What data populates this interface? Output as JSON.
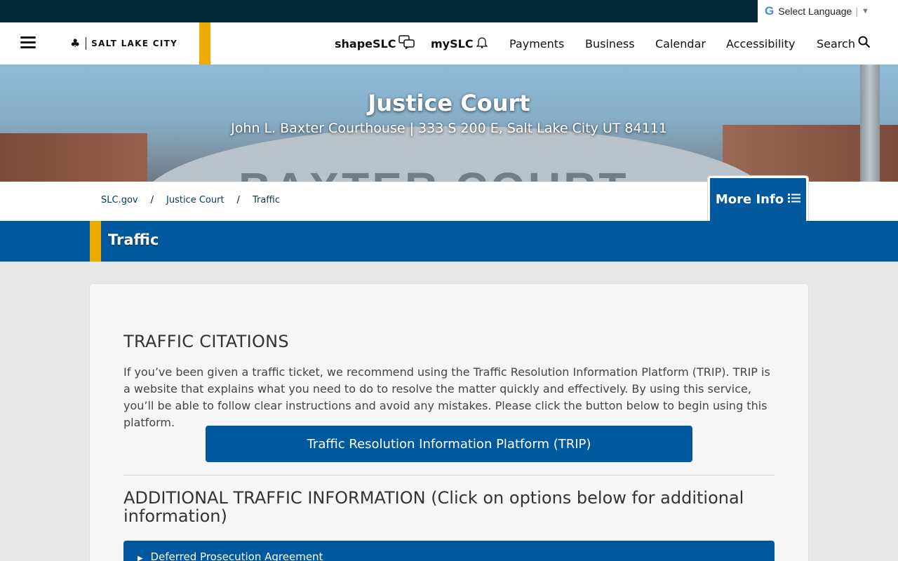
{
  "language": {
    "label": "Select Language",
    "g_logo": "G",
    "arrow": "▼"
  },
  "header": {
    "logo_text": "SALT LAKE CITY",
    "nav": [
      {
        "label": "shapeSLC",
        "icon": "chat-bubbles-icon"
      },
      {
        "label": "mySLC",
        "icon": "bell-icon"
      },
      {
        "label": "Payments"
      },
      {
        "label": "Business"
      },
      {
        "label": "Calendar"
      },
      {
        "label": "Accessibility"
      },
      {
        "label": "Search",
        "icon": "search-icon"
      }
    ]
  },
  "hero": {
    "title": "Justice Court",
    "subtitle": "John L. Baxter Courthouse | 333 S 200 E, Salt Lake City UT 84111",
    "carved_text": "BAXTER COURT"
  },
  "breadcrumb": [
    "SLC.gov",
    "Justice Court",
    "Traffic"
  ],
  "more_info": {
    "label": "More Info"
  },
  "page_title": "Traffic",
  "content": {
    "heading": "TRAFFIC CITATIONS",
    "paragraph": "If you’ve been given a traffic ticket, we recommend using the Traffic Resolution Information Platform (TRIP). TRIP is a website that explains what you need to do to resolve the matter quickly and effectively. By using this service, you’ll be able to follow clear instructions and avoid any mistakes. Please click the button below to begin using this platform.",
    "trip_button": "Traffic Resolution Information Platform (TRIP)",
    "additional_heading": "ADDITIONAL TRAFFIC INFORMATION (Click on options below for additional information)",
    "accordion_items": [
      "Deferred Prosecution Agreement"
    ]
  },
  "colors": {
    "primary_blue": "#00599c",
    "gold": "#eeac00",
    "top_strip": "#022a38"
  }
}
